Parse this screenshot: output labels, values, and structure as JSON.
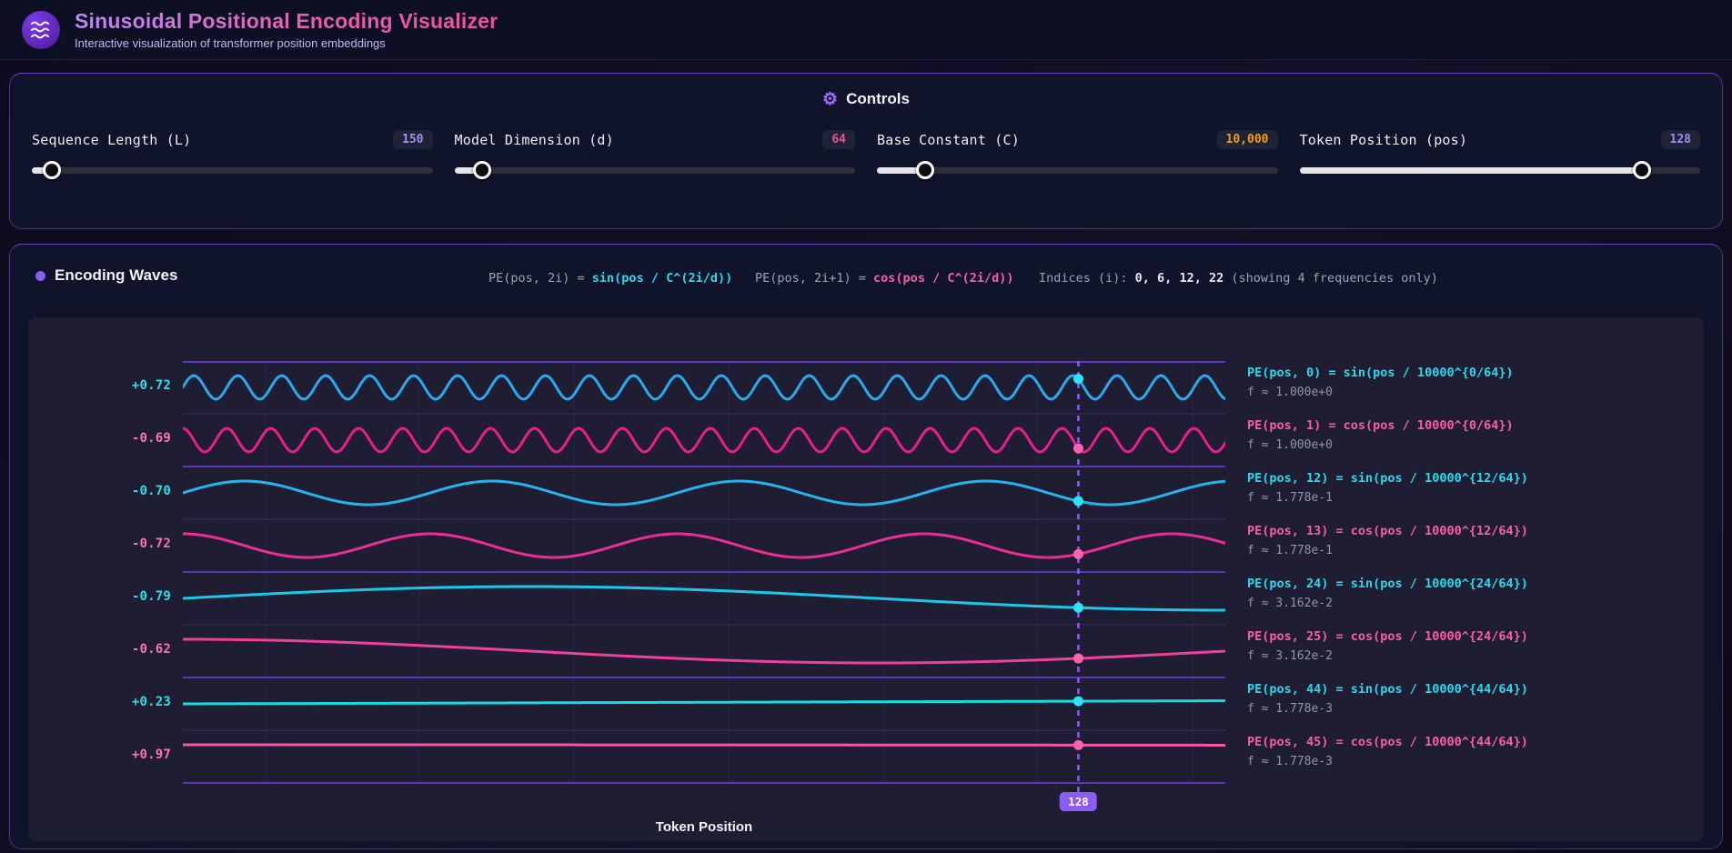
{
  "header": {
    "title": "Sinusoidal Positional Encoding Visualizer",
    "subtitle": "Interactive visualization of transformer position embeddings",
    "logo_icon": "waves-icon"
  },
  "controls": {
    "title": "Controls",
    "icon": "gear-icon",
    "sliders": [
      {
        "id": "sequence-length",
        "label": "Sequence Length (L)",
        "value": "150",
        "value_color": "#a78bfa",
        "thumb_fraction": 0.05
      },
      {
        "id": "model-dimension",
        "label": "Model Dimension (d)",
        "value": "64",
        "value_color": "#f0509f",
        "thumb_fraction": 0.07
      },
      {
        "id": "base-constant",
        "label": "Base Constant (C)",
        "value": "10,000",
        "value_color": "#f59e0b",
        "thumb_fraction": 0.12
      },
      {
        "id": "token-position",
        "label": "Token Position (pos)",
        "value": "128",
        "value_color": "#a78bfa",
        "thumb_fraction": 0.855
      }
    ]
  },
  "waves": {
    "title": "Encoding Waves",
    "formula_sin_prefix": "PE(pos, 2i) = ",
    "formula_sin": "sin(pos / C^(2i/d))",
    "formula_cos_prefix": "PE(pos, 2i+1) = ",
    "formula_cos": "cos(pos / C^(2i/d))",
    "indices_prefix": "Indices (i): ",
    "indices_values": "0, 6, 12, 22",
    "indices_note": " (showing 4 frequencies only)"
  },
  "chart_data": {
    "type": "line",
    "x_label": "Token Position",
    "x_range": [
      0,
      149
    ],
    "token_position": 128,
    "marker_label": "128",
    "marker_color": "#8b5cf6",
    "grid": true,
    "accent_cyan": "#22d3ee",
    "accent_pink": "#f472b6",
    "rows": [
      {
        "dim": 0,
        "kind": "sin",
        "freq": 1.0,
        "formula": "PE(pos, 0) = sin(pos / 10000^{0/64})",
        "freq_label": "f ≈ 1.000e+0",
        "value_label": "+0.72",
        "color": "#2aa9f0",
        "dot_color": "#2be4fa",
        "label_color": "#27e0e8"
      },
      {
        "dim": 1,
        "kind": "cos",
        "freq": 1.0,
        "formula": "PE(pos, 1) = cos(pos / 10000^{0/64})",
        "freq_label": "f ≈ 1.000e+0",
        "value_label": "-0.69",
        "color": "#e81f8b",
        "dot_color": "#ff63ae",
        "label_color": "#f973b5"
      },
      {
        "dim": 12,
        "kind": "sin",
        "freq": 0.177828,
        "formula": "PE(pos, 12) = sin(pos / 10000^{12/64})",
        "freq_label": "f ≈ 1.778e-1",
        "value_label": "-0.70",
        "color": "#24b3f0",
        "dot_color": "#2be4fa",
        "label_color": "#27e0e8"
      },
      {
        "dim": 13,
        "kind": "cos",
        "freq": 0.177828,
        "formula": "PE(pos, 13) = cos(pos / 10000^{12/64})",
        "freq_label": "f ≈ 1.778e-1",
        "value_label": "-0.72",
        "color": "#ea2f94",
        "dot_color": "#ff63ae",
        "label_color": "#f973b5"
      },
      {
        "dim": 24,
        "kind": "sin",
        "freq": 0.0316228,
        "formula": "PE(pos, 24) = sin(pos / 10000^{24/64})",
        "freq_label": "f ≈ 3.162e-2",
        "value_label": "-0.79",
        "color": "#1bc8ea",
        "dot_color": "#2be4fa",
        "label_color": "#27e0e8"
      },
      {
        "dim": 25,
        "kind": "cos",
        "freq": 0.0316228,
        "formula": "PE(pos, 25) = cos(pos / 10000^{24/64})",
        "freq_label": "f ≈ 3.162e-2",
        "value_label": "-0.62",
        "color": "#ee3f9d",
        "dot_color": "#ff63ae",
        "label_color": "#f973b5"
      },
      {
        "dim": 44,
        "kind": "sin",
        "freq": 0.00177828,
        "formula": "PE(pos, 44) = sin(pos / 10000^{44/64})",
        "freq_label": "f ≈ 1.778e-3",
        "value_label": "+0.23",
        "color": "#16dce2",
        "dot_color": "#2be4fa",
        "label_color": "#27e0e8"
      },
      {
        "dim": 45,
        "kind": "cos",
        "freq": 0.00177828,
        "formula": "PE(pos, 45) = cos(pos / 10000^{44/64})",
        "freq_label": "f ≈ 1.778e-3",
        "value_label": "+0.97",
        "color": "#f455a8",
        "dot_color": "#ff63ae",
        "label_color": "#f973b5"
      }
    ]
  }
}
